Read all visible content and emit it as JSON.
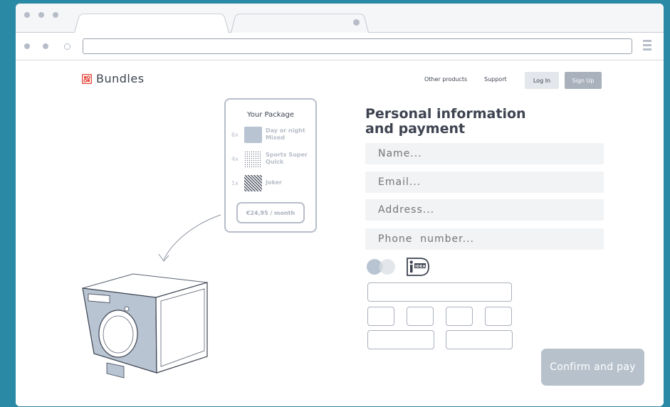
{
  "browser": {
    "tabs": [
      {
        "label": ""
      },
      {
        "label": ""
      }
    ],
    "address": ""
  },
  "header": {
    "logo_text": "Bundles",
    "nav": [
      {
        "label": "Other products"
      },
      {
        "label": "Support"
      }
    ],
    "login_label": "Log In",
    "signup_label": "Sign Up"
  },
  "package": {
    "title": "Your Package",
    "items": [
      {
        "qty": "6x",
        "name_line1": "Day or night",
        "name_line2": "Mixed",
        "pattern": "solid"
      },
      {
        "qty": "4x",
        "name_line1": "Sports Super",
        "name_line2": "Quick",
        "pattern": "dots"
      },
      {
        "qty": "1x",
        "name_line1": "Joker",
        "name_line2": "",
        "pattern": "stripes"
      }
    ],
    "price": "€24,95 / month"
  },
  "form": {
    "title_line1": "Personal information",
    "title_line2": "and payment",
    "fields": [
      {
        "placeholder": "Name..."
      },
      {
        "placeholder": "Email..."
      },
      {
        "placeholder": "Address..."
      },
      {
        "placeholder": "Phone  number..."
      }
    ],
    "payment_methods": [
      {
        "icon": "credit-card-icon"
      },
      {
        "icon": "ideal-icon"
      }
    ],
    "confirm_label": "Confirm and pay"
  },
  "colors": {
    "background": "#2a8aa6",
    "logo_accent": "#e5483c",
    "primary_button": "#b7c1cc",
    "signup_button": "#a9b1bd",
    "machine_fill": "#b8c4d2"
  }
}
